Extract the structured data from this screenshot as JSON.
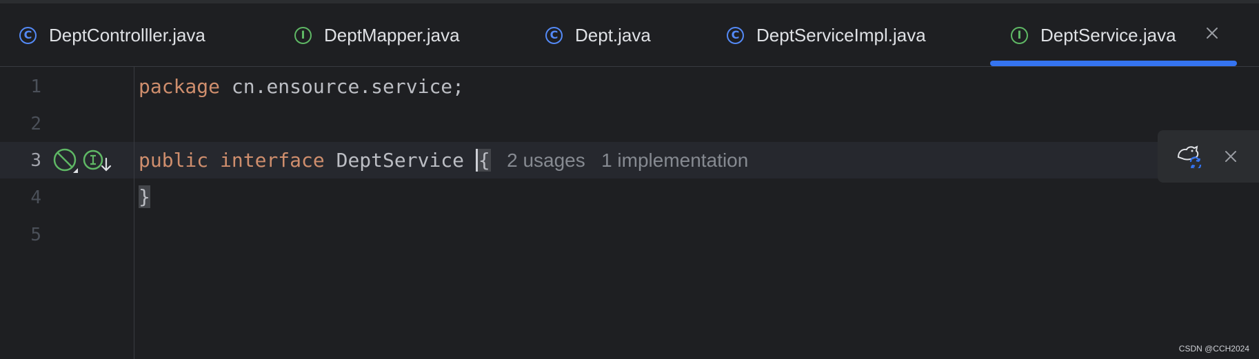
{
  "tabs": [
    {
      "label": "DeptControlller.java",
      "icon": "class-icon",
      "icon_glyph": "C",
      "active": false
    },
    {
      "label": "DeptMapper.java",
      "icon": "interface-icon",
      "icon_glyph": "I",
      "active": false
    },
    {
      "label": "Dept.java",
      "icon": "class-icon",
      "icon_glyph": "C",
      "active": false
    },
    {
      "label": "DeptServiceImpl.java",
      "icon": "class-icon",
      "icon_glyph": "C",
      "active": false
    },
    {
      "label": "DeptService.java",
      "icon": "interface-icon",
      "icon_glyph": "I",
      "active": true
    }
  ],
  "editor": {
    "line_numbers": [
      "1",
      "2",
      "3",
      "4",
      "5"
    ],
    "active_line": "3",
    "lines": {
      "l1_keyword": "package",
      "l1_rest": " cn.ensource.service;",
      "l3_kw1": "public",
      "l3_kw2": "interface",
      "l3_name": "DeptService",
      "l3_open": "{",
      "l4_close": "}"
    },
    "inlay_usages": "2 usages",
    "inlay_impls": "1 implementation"
  },
  "notification": {
    "icon": "maven-sync-icon",
    "close_icon": "close-icon"
  },
  "watermark": "CSDN @CCH2024",
  "colors": {
    "background": "#1e1f22",
    "keyword": "#cf8e6d",
    "text": "#bcbec4",
    "accent": "#3574f0",
    "class_icon": "#548af7",
    "interface_icon": "#5fb865"
  }
}
